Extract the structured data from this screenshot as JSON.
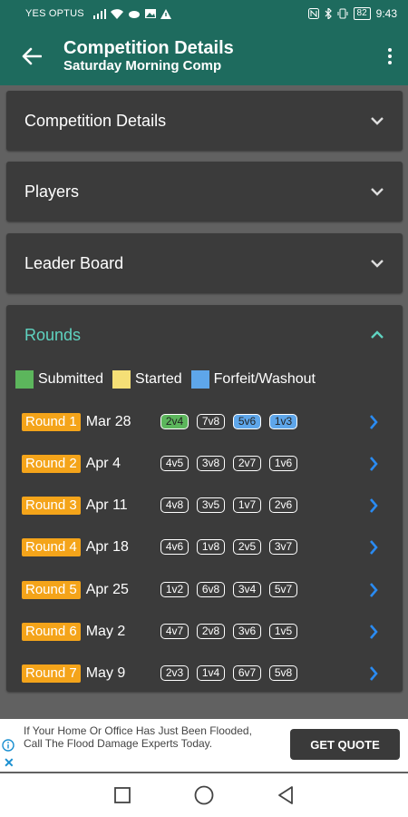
{
  "status": {
    "carrier": "YES OPTUS",
    "battery": "82",
    "time": "9:43"
  },
  "appbar": {
    "title": "Competition Details",
    "subtitle": "Saturday Morning Comp"
  },
  "sections": [
    {
      "label": "Competition Details"
    },
    {
      "label": "Players"
    },
    {
      "label": "Leader Board"
    }
  ],
  "rounds": {
    "header": "Rounds",
    "legend": [
      {
        "label": "Submitted",
        "color": "#5cb65c"
      },
      {
        "label": "Started",
        "color": "#f5df76"
      },
      {
        "label": "Forfeit/Washout",
        "color": "#5ea6ea"
      }
    ],
    "items": [
      {
        "round": "Round 1",
        "date": "Mar 28",
        "matches": [
          {
            "label": "2v4",
            "status": "submitted"
          },
          {
            "label": "7v8",
            "status": "none"
          },
          {
            "label": "5v6",
            "status": "forfeit"
          },
          {
            "label": "1v3",
            "status": "forfeit"
          }
        ]
      },
      {
        "round": "Round 2",
        "date": "Apr 4",
        "matches": [
          {
            "label": "4v5",
            "status": "none"
          },
          {
            "label": "3v8",
            "status": "none"
          },
          {
            "label": "2v7",
            "status": "none"
          },
          {
            "label": "1v6",
            "status": "none"
          }
        ]
      },
      {
        "round": "Round 3",
        "date": "Apr 11",
        "matches": [
          {
            "label": "4v8",
            "status": "none"
          },
          {
            "label": "3v5",
            "status": "none"
          },
          {
            "label": "1v7",
            "status": "none"
          },
          {
            "label": "2v6",
            "status": "none"
          }
        ]
      },
      {
        "round": "Round 4",
        "date": "Apr 18",
        "matches": [
          {
            "label": "4v6",
            "status": "none"
          },
          {
            "label": "1v8",
            "status": "none"
          },
          {
            "label": "2v5",
            "status": "none"
          },
          {
            "label": "3v7",
            "status": "none"
          }
        ]
      },
      {
        "round": "Round 5",
        "date": "Apr 25",
        "matches": [
          {
            "label": "1v2",
            "status": "none"
          },
          {
            "label": "6v8",
            "status": "none"
          },
          {
            "label": "3v4",
            "status": "none"
          },
          {
            "label": "5v7",
            "status": "none"
          }
        ]
      },
      {
        "round": "Round 6",
        "date": "May 2",
        "matches": [
          {
            "label": "4v7",
            "status": "none"
          },
          {
            "label": "2v8",
            "status": "none"
          },
          {
            "label": "3v6",
            "status": "none"
          },
          {
            "label": "1v5",
            "status": "none"
          }
        ]
      },
      {
        "round": "Round 7",
        "date": "May 9",
        "matches": [
          {
            "label": "2v3",
            "status": "none"
          },
          {
            "label": "1v4",
            "status": "none"
          },
          {
            "label": "6v7",
            "status": "none"
          },
          {
            "label": "5v8",
            "status": "none"
          }
        ]
      }
    ]
  },
  "ad": {
    "text": "If Your Home Or Office Has Just Been Flooded, Call The Flood Damage Experts Today.",
    "cta": "GET QUOTE"
  },
  "colors": {
    "primary": "#1e6b5e",
    "round_tag": "#f4a41a",
    "accent_teal": "#5fd3c0",
    "arrow_blue": "#2a8bf2"
  }
}
